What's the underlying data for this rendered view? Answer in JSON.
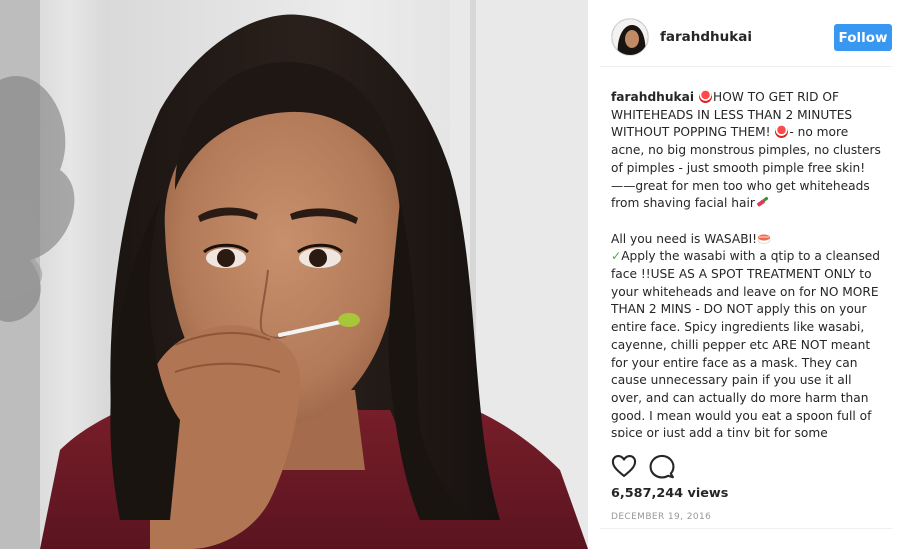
{
  "post": {
    "username": "farahdhukai",
    "follow_label": "Follow",
    "caption": {
      "author": "farahdhukai",
      "para1_a": "HOW TO GET RID OF WHITEHEADS IN LESS THAN 2 MINUTES WITHOUT POPPING THEM! ",
      "para1_b": "- no more acne, no big monstrous pimples, no clusters of pimples - just smooth pimple free skin! ——great for men too who get whiteheads from shaving facial hair",
      "para2_a": "All you need is WASABI!",
      "para2_check": "✓",
      "para2_b": "Apply the wasabi with a qtip to a cleansed face !!USE AS A SPOT TREATMENT ONLY to your whiteheads and leave on for NO MORE THAN 2 MINS - DO NOT apply this on your entire face. Spicy ingredients like wasabi, cayenne, chilli pepper etc ARE NOT meant for your entire face as a mask. They can cause unnecessary pain if you use it all over, and can actually do more harm than good. I mean would you eat a spoon full of spice or just add a tiny bit for some"
    },
    "views": "6,587,244 views",
    "date": "DECEMBER 19, 2016",
    "icons": {
      "like": "heart-icon",
      "comment": "comment-icon",
      "pill_emoji": "pill-emoji-icon",
      "tube_emoji": "lipstick-emoji-icon",
      "sushi_emoji": "sushi-emoji-icon"
    },
    "colors": {
      "follow_button": "#3897f0",
      "text": "#262626",
      "muted": "#999999",
      "divider": "#efefef"
    }
  }
}
